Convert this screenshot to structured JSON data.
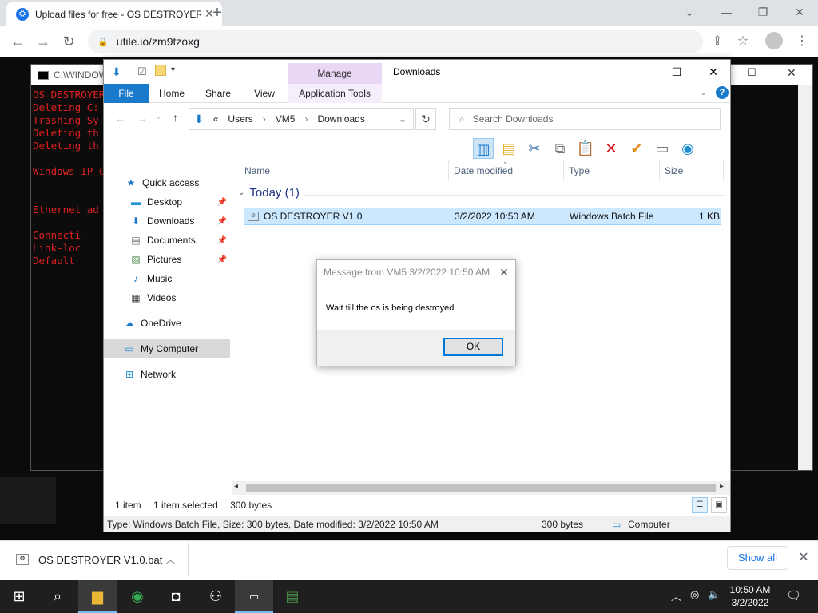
{
  "browser": {
    "tab_title": "Upload files for free - OS DESTROYER",
    "favicon_glyph": "⛭",
    "url": "ufile.io/zm9tzoxg",
    "accent": "#1a73e8"
  },
  "console": {
    "title": "C:\\WINDOWS",
    "lines": [
      "OS DESTROYER",
      "Deleting C:",
      "Trashing Sy",
      "Deleting th",
      "Deleting th",
      "",
      "Windows IP C",
      "",
      "",
      "Ethernet ad",
      "",
      "   Connecti",
      "   Link-loc",
      "   Default"
    ],
    "text_color": "#e02020"
  },
  "explorer": {
    "title": "Downloads",
    "manage_label": "Manage",
    "ribbon_tabs": [
      "File",
      "Home",
      "Share",
      "View",
      "Application Tools"
    ],
    "breadcrumb": [
      "«",
      "Users",
      "VM5",
      "Downloads"
    ],
    "search_placeholder": "Search Downloads",
    "nav": {
      "quick_access": "Quick access",
      "desktop": "Desktop",
      "downloads": "Downloads",
      "documents": "Documents",
      "pictures": "Pictures",
      "music": "Music",
      "videos": "Videos",
      "onedrive": "OneDrive",
      "my_computer": "My Computer",
      "network": "Network"
    },
    "columns": [
      "Name",
      "Date modified",
      "Type",
      "Size"
    ],
    "group_label": "Today (1)",
    "file": {
      "name": "OS DESTROYER V1.0",
      "date": "3/2/2022 10:50 AM",
      "type": "Windows Batch File",
      "size": "1 KB"
    },
    "status": {
      "count": "1 item",
      "selected": "1 item selected",
      "bytes": "300 bytes"
    },
    "statusbar": {
      "details": "Type: Windows Batch File, Size: 300 bytes, Date modified: 3/2/2022 10:50 AM",
      "size": "300 bytes",
      "location": "Computer"
    }
  },
  "message": {
    "title": "Message from VM5 3/2/2022 10:50 AM",
    "text": "Wait till the os is being destroyed",
    "ok_label": "OK"
  },
  "download_shelf": {
    "file_name": "OS DESTROYER V1.0.bat",
    "show_all": "Show all"
  },
  "taskbar": {
    "time": "10:50 AM",
    "date": "3/2/2022"
  }
}
